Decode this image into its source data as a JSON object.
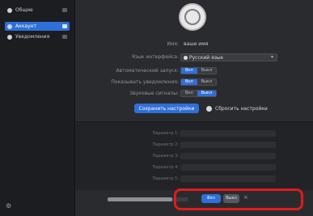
{
  "sidebar": {
    "items": [
      {
        "label": "Общие"
      },
      {
        "label": "Аккаунт"
      },
      {
        "label": "Уведомления"
      }
    ]
  },
  "main": {
    "name_label": "Имя:",
    "name_value": "ваше имя",
    "rows": [
      {
        "label": "Язык интерфейса:",
        "value": "Русский язык"
      },
      {
        "label": "Автоматический запуск:",
        "on": "Вкл",
        "off": "Выкл"
      },
      {
        "label": "Показывать уведомления:",
        "on": "Вкл",
        "off": "Выкл"
      },
      {
        "label": "Звуковые сигналы:",
        "on": "Вкл",
        "off": "Выкл"
      }
    ],
    "primary_button": "Сохранить настройки",
    "secondary_button": "Сбросить настройки"
  },
  "dimmed": {
    "rows": [
      {
        "label": "Параметр 1:"
      },
      {
        "label": "Параметр 2:"
      },
      {
        "label": "Параметр 3:"
      },
      {
        "label": "Параметр 4:"
      },
      {
        "label": "Параметр 5:"
      }
    ]
  },
  "highlighted": {
    "bar_fraction": 0.8,
    "on_label": "Вкл",
    "off_label": "Выкл",
    "highlight_color": "#e01b1b"
  },
  "colors": {
    "accent": "#2f6fd9",
    "sidebar_bg": "#1c1d20",
    "main_bg": "#2a2b2e"
  }
}
